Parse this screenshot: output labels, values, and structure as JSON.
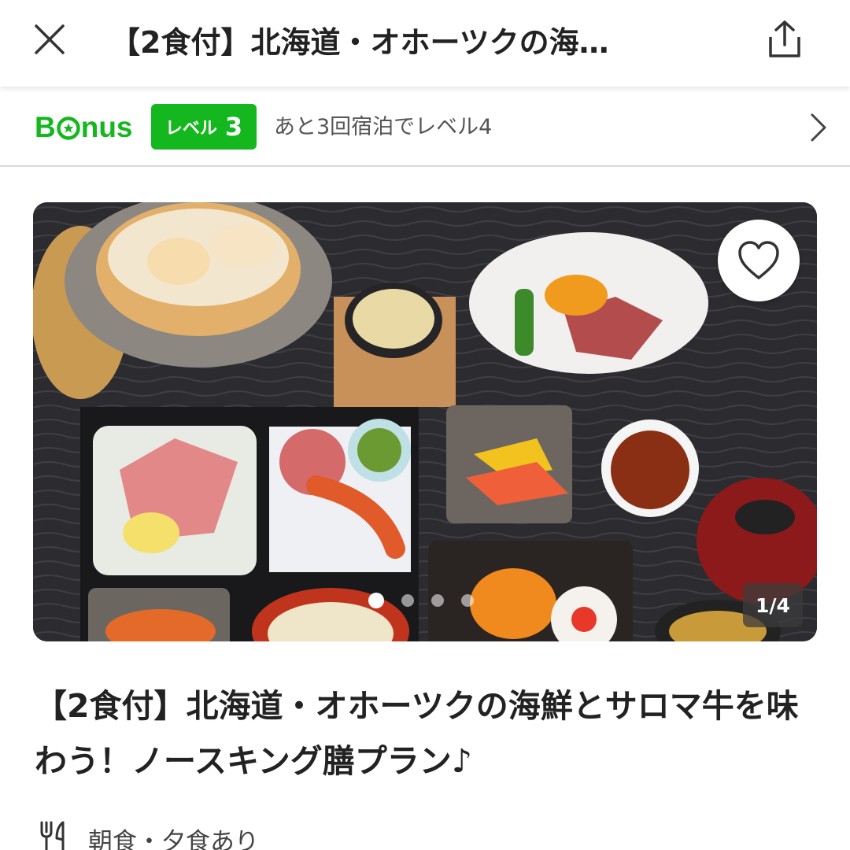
{
  "header": {
    "title": "【2食付】北海道・オホーツクの海…",
    "close_icon": "close-icon",
    "share_icon": "share-icon"
  },
  "bonus": {
    "logo_prefix": "B",
    "logo_suffix": "nus",
    "level_label": "レベル",
    "level_number": "3",
    "next_level_text": "あと3回宿泊でレベル4",
    "accent_color": "#14b81e"
  },
  "photo": {
    "counter": "1/4",
    "current_index": 1,
    "total": 4,
    "favorite_icon": "heart-outline-icon"
  },
  "plan": {
    "title": "【2食付】北海道・オホーツクの海鮮とサロマ牛を味わう！ノースキング膳プラン♪"
  },
  "meal": {
    "icon": "fork-knife-icon",
    "text": "朝食・夕食あり"
  }
}
